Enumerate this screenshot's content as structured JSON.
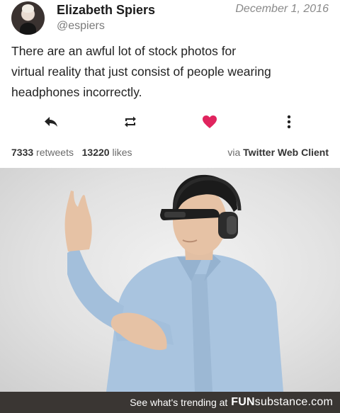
{
  "tweet": {
    "author_name": "Elizabeth Spiers",
    "author_handle": "@espiers",
    "date": "December 1, 2016",
    "text_lines": [
      "There are an awful lot of stock photos for",
      "virtual reality that just consist of people wearing",
      "headphones incorrectly."
    ],
    "retweet_count": "7333",
    "retweets_label": "retweets",
    "like_count": "13220",
    "likes_label": "likes",
    "via_label": "via",
    "client": "Twitter Web Client"
  },
  "actions": {
    "reply_icon": "reply-icon",
    "retweet_icon": "retweet-icon",
    "like_icon": "heart-icon",
    "more_icon": "more-vertical-icon",
    "like_color": "#e0245e"
  },
  "footer": {
    "prompt": "See what's trending at",
    "brand_bold": "FUN",
    "brand_rest": "substance.com"
  },
  "colors": {
    "footer_bg": "#3a3633",
    "shirt": "#a9c4df"
  }
}
